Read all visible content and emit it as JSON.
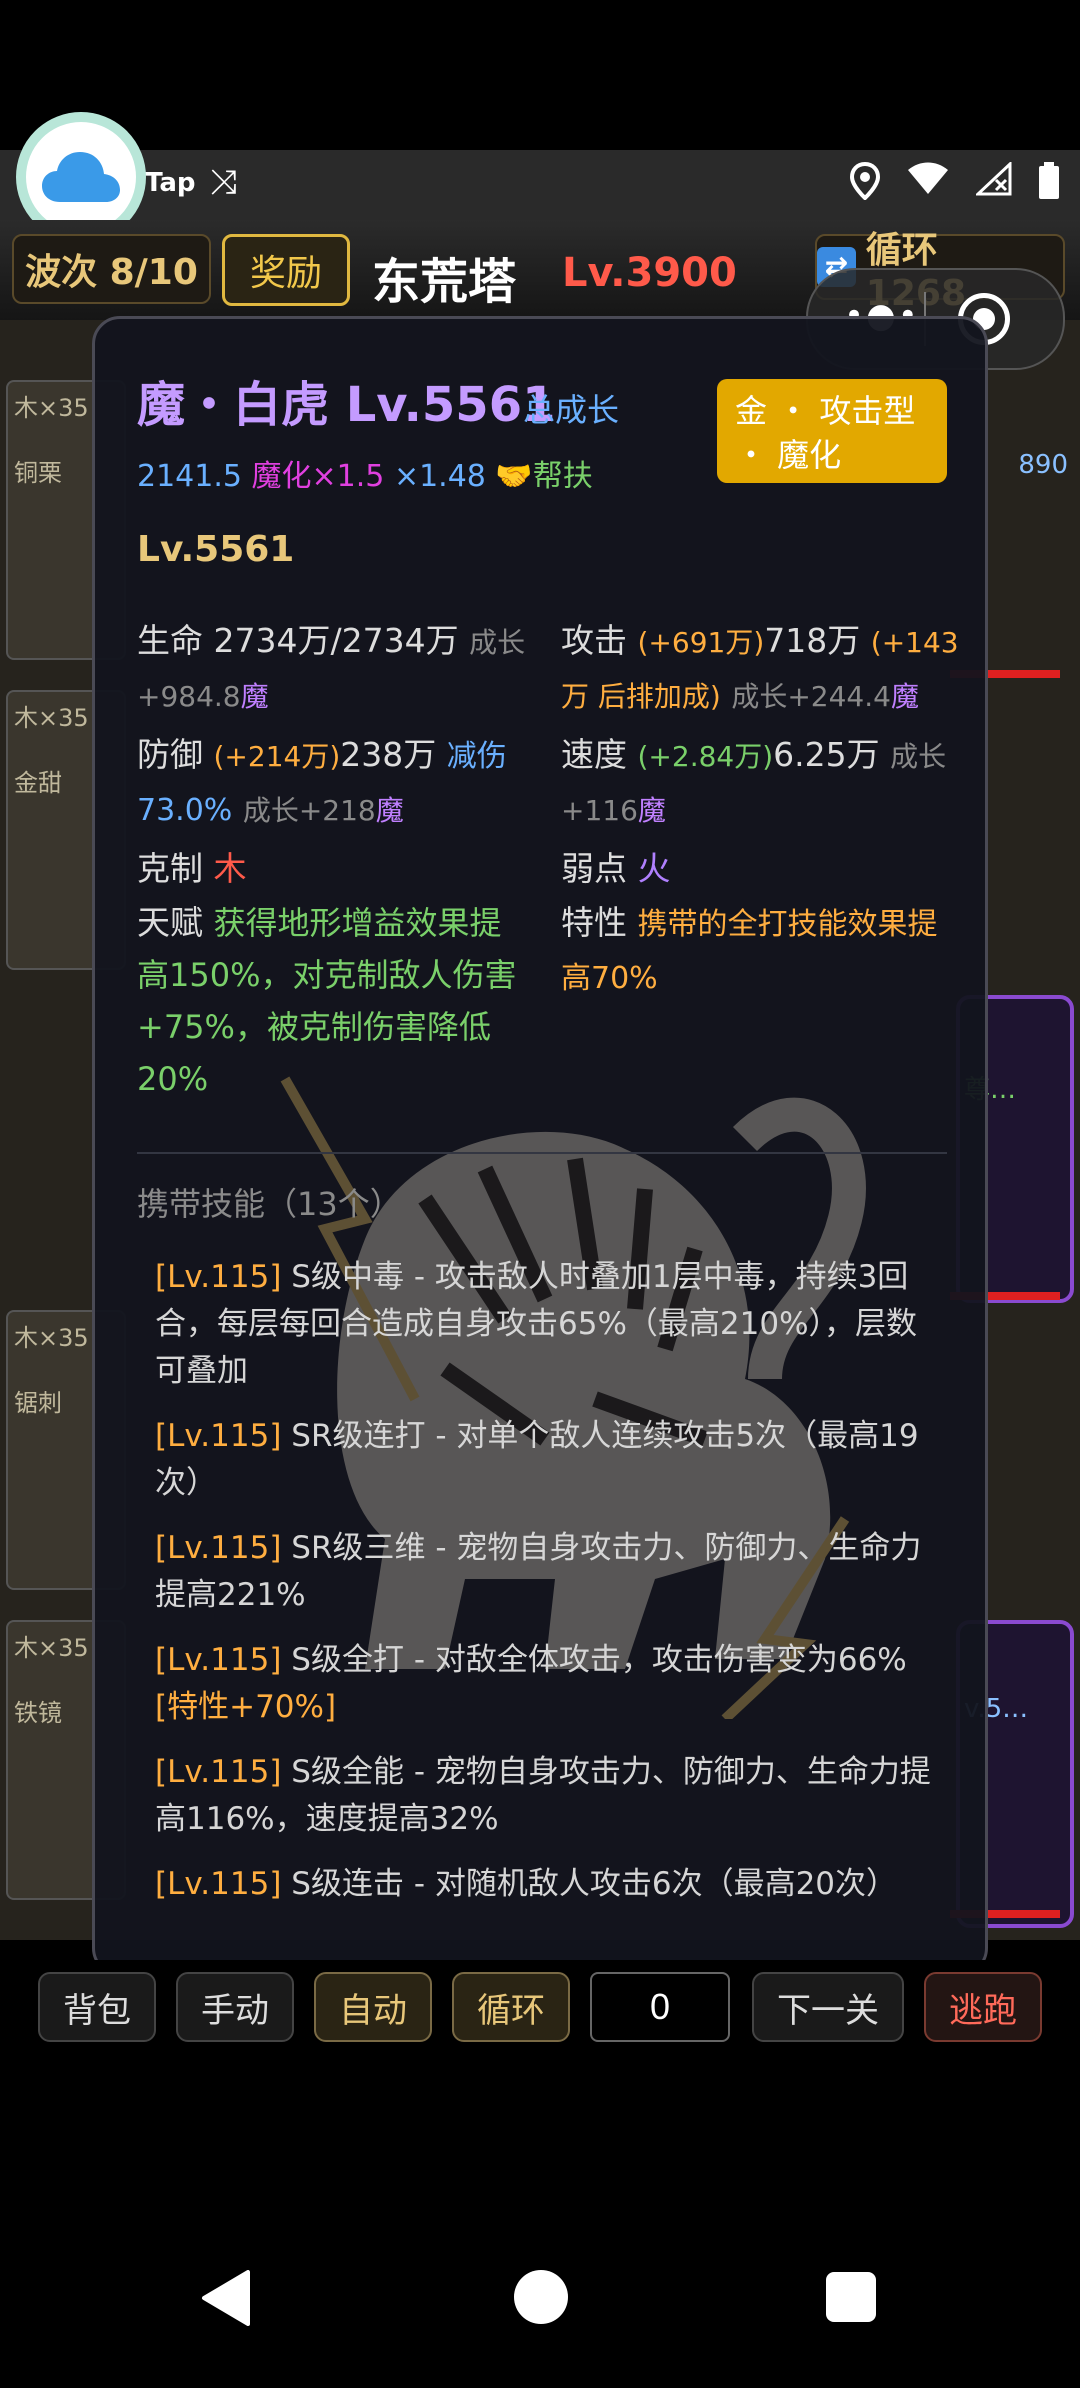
{
  "status_bar": {
    "app_text": "Tap",
    "icons": [
      "shuffle-icon",
      "location-icon",
      "wifi-icon",
      "signal-icon",
      "battery-icon"
    ]
  },
  "top_bar": {
    "wave": "波次 8/10",
    "reward": "奖励",
    "tower_name": "东荒塔",
    "tower_level": "Lv.3900",
    "loop": "循环 1268"
  },
  "background_cards": {
    "left": [
      {
        "tag": "木×35",
        "name": "铜栗"
      },
      {
        "tag": "木×35",
        "name": "金甜"
      },
      {
        "tag": "木×35",
        "name": "锯刺"
      },
      {
        "tag": "木×35",
        "name": "铁镜"
      }
    ],
    "right_texts": [
      "890",
      "尊…",
      "v.5…"
    ]
  },
  "pet": {
    "name": "魔・白虎 Lv.5561",
    "growth_link": "总成长",
    "type_badge": "金 ・ 攻击型 ・ 魔化",
    "mult_base": "2141.5",
    "mult_mohua": "魔化×1.5",
    "mult_extra": "×1.48",
    "mult_help": "帮扶",
    "level": "Lv.5561",
    "hp_label": "生命",
    "hp_value": "2734万/2734万",
    "hp_growth": "成长+984.8",
    "hp_mo": "魔",
    "atk_label": "攻击",
    "atk_bonus": "(+691万)",
    "atk_value": "718万",
    "atk_extra": "(+143万 后排加成)",
    "atk_growth": "成长+244.4",
    "atk_mo": "魔",
    "def_label": "防御",
    "def_bonus": "(+214万)",
    "def_value": "238万",
    "def_reduce": "减伤73.0%",
    "def_growth": "成长+218",
    "def_mo": "魔",
    "spd_label": "速度",
    "spd_bonus": "(+2.84万)",
    "spd_value": "6.25万",
    "spd_growth": "成长+116",
    "spd_mo": "魔",
    "counter_label": "克制",
    "counter_value": "木",
    "weak_label": "弱点",
    "weak_value": "火",
    "talent_label": "天赋",
    "talent_value": "获得地形增益效果提高150%，对克制敌人伤害+75%，被克制伤害降低20%",
    "trait_label": "特性",
    "trait_value": "携带的全打技能效果提高70%"
  },
  "skills": {
    "title": "携带技能（13个）",
    "items": [
      {
        "lv": "[Lv.115]",
        "text": "S级中毒 - 攻击敌人时叠加1层中毒，持续3回合，每层每回合造成自身攻击65%（最高210%），层数可叠加"
      },
      {
        "lv": "[Lv.115]",
        "text": "SR级连打 - 对单个敌人连续攻击5次（最高19次）"
      },
      {
        "lv": "[Lv.115]",
        "text": "SR级三维 - 宠物自身攻击力、防御力、生命力提高221%"
      },
      {
        "lv": "[Lv.115]",
        "text": "S级全打 - 对敌全体攻击，攻击伤害变为66%",
        "trait": "[特性+70%]"
      },
      {
        "lv": "[Lv.115]",
        "text": "S级全能 - 宠物自身攻击力、防御力、生命力提高116%，速度提高32%"
      },
      {
        "lv": "[Lv.115]",
        "text": "S级连击 - 对随机敌人攻击6次（最高20次）"
      }
    ]
  },
  "bottom_bar": {
    "bag": "背包",
    "manual": "手动",
    "auto": "自动",
    "loop": "循环",
    "input_value": "0",
    "next": "下一关",
    "flee": "逃跑"
  },
  "colors": {
    "accent_gold": "#e2a800",
    "pet_name": "#c49bff",
    "level_red": "#ff5a4a"
  }
}
